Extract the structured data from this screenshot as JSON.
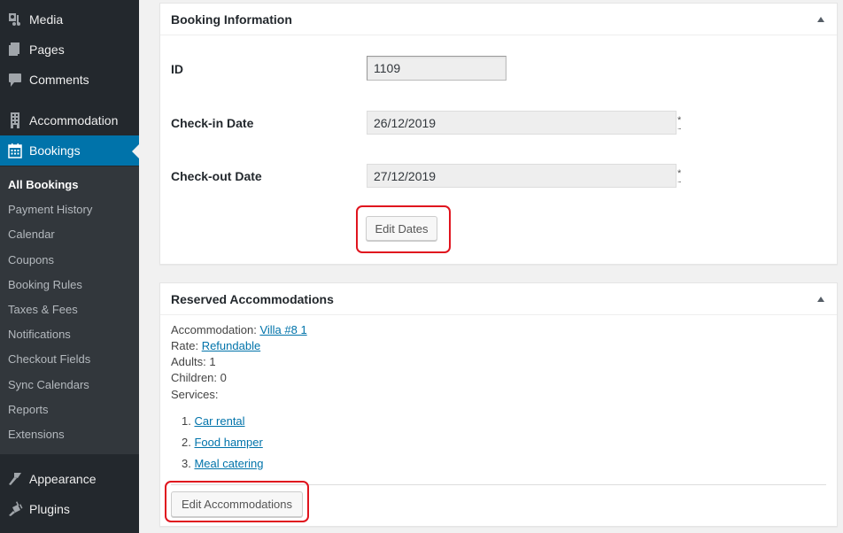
{
  "sidebar": {
    "top_items": [
      {
        "label": "Media",
        "icon": "media-icon"
      },
      {
        "label": "Pages",
        "icon": "pages-icon"
      },
      {
        "label": "Comments",
        "icon": "comments-icon"
      },
      {
        "label": "Accommodation",
        "icon": "building-icon"
      },
      {
        "label": "Bookings",
        "icon": "calendar-icon",
        "current": true
      }
    ],
    "submenu": [
      {
        "label": "All Bookings",
        "current": true
      },
      {
        "label": "Payment History"
      },
      {
        "label": "Calendar"
      },
      {
        "label": "Coupons"
      },
      {
        "label": "Booking Rules"
      },
      {
        "label": "Taxes & Fees"
      },
      {
        "label": "Notifications"
      },
      {
        "label": "Checkout Fields"
      },
      {
        "label": "Sync Calendars"
      },
      {
        "label": "Reports"
      },
      {
        "label": "Extensions"
      }
    ],
    "bottom_items": [
      {
        "label": "Appearance",
        "icon": "paintbrush-icon"
      },
      {
        "label": "Plugins",
        "icon": "plugin-icon"
      }
    ]
  },
  "booking_info": {
    "title": "Booking Information",
    "id_label": "ID",
    "id_value": "1109",
    "checkin_label": "Check-in Date",
    "checkin_value": "26/12/2019",
    "checkout_label": "Check-out Date",
    "checkout_value": "27/12/2019",
    "required_mark": "*",
    "edit_dates_label": "Edit Dates"
  },
  "reserved": {
    "title": "Reserved Accommodations",
    "accommodation_label": "Accommodation: ",
    "accommodation_value": "Villa #8 1",
    "rate_label": "Rate: ",
    "rate_value": "Refundable",
    "adults": "Adults: 1",
    "children": "Children: 0",
    "services_label": "Services:",
    "services": [
      {
        "num": "1. ",
        "label": "Car rental"
      },
      {
        "num": "2. ",
        "label": "Food hamper"
      },
      {
        "num": "3. ",
        "label": "Meal catering"
      }
    ],
    "edit_accommodations_label": "Edit Accommodations"
  },
  "colors": {
    "sidebar_bg": "#23282d",
    "submenu_bg": "#32373c",
    "accent": "#0073aa",
    "highlight": "#e0141e",
    "link": "#0073aa"
  }
}
